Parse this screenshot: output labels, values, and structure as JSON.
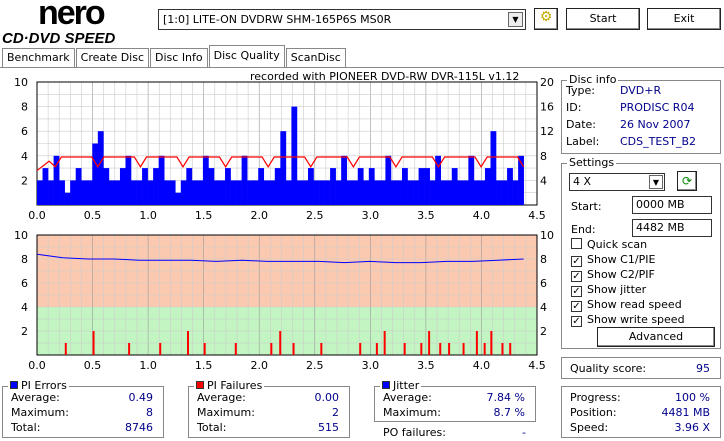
{
  "app": {
    "logo_top": "nero",
    "logo_bottom": "CD·DVD SPEED"
  },
  "toolbar": {
    "drive": "[1:0]  LITE-ON DVDRW SHM-165P6S MS0R",
    "start": "Start",
    "exit": "Exit"
  },
  "tabs": [
    "Benchmark",
    "Create Disc",
    "Disc Info",
    "Disc Quality",
    "ScanDisc"
  ],
  "active_tab": "Disc Quality",
  "recorded_with": "recorded with PIONEER DVD-RW  DVR-115L v1.12",
  "disc_info": {
    "title": "Disc info",
    "rows": [
      {
        "label": "Type:",
        "value": "DVD+R"
      },
      {
        "label": "ID:",
        "value": "PRODISC R04"
      },
      {
        "label": "Date:",
        "value": "26 Nov 2007"
      },
      {
        "label": "Label:",
        "value": "CDS_TEST_B2"
      }
    ]
  },
  "settings": {
    "title": "Settings",
    "speed": "4 X",
    "start_label": "Start:",
    "start_value": "0000 MB",
    "end_label": "End:",
    "end_value": "4482 MB",
    "checks": [
      {
        "label": "Quick scan",
        "checked": false
      },
      {
        "label": "Show C1/PIE",
        "checked": true
      },
      {
        "label": "Show C2/PIF",
        "checked": true
      },
      {
        "label": "Show jitter",
        "checked": true
      },
      {
        "label": "Show read speed",
        "checked": true
      },
      {
        "label": "Show write speed",
        "checked": true
      }
    ],
    "advanced": "Advanced"
  },
  "quality": {
    "label": "Quality score:",
    "value": "95"
  },
  "progress": {
    "rows": [
      {
        "label": "Progress:",
        "value": "100 %"
      },
      {
        "label": "Position:",
        "value": "4481 MB"
      },
      {
        "label": "Speed:",
        "value": "3.96 X"
      }
    ]
  },
  "pi_errors": {
    "title": "PI Errors",
    "color": "#0000ff",
    "rows": [
      {
        "label": "Average:",
        "value": "0.49"
      },
      {
        "label": "Maximum:",
        "value": "8"
      },
      {
        "label": "Total:",
        "value": "8746"
      }
    ]
  },
  "pi_failures": {
    "title": "PI Failures",
    "color": "#ff0000",
    "rows": [
      {
        "label": "Average:",
        "value": "0.00"
      },
      {
        "label": "Maximum:",
        "value": "2"
      },
      {
        "label": "Total:",
        "value": "515"
      }
    ]
  },
  "jitter": {
    "title": "Jitter",
    "color": "#0000ff",
    "rows": [
      {
        "label": "Average:",
        "value": "7.84 %"
      },
      {
        "label": "Maximum:",
        "value": "8.7 %"
      }
    ],
    "po_label": "PO failures:",
    "po_value": "-"
  },
  "chart_data": [
    {
      "type": "bar",
      "name": "PI errors / read speed",
      "xlim": [
        0,
        4.5
      ],
      "ylim": [
        0,
        10
      ],
      "y2lim": [
        0,
        20
      ],
      "xticks": [
        "0.0",
        "0.5",
        "1.0",
        "1.5",
        "2.0",
        "2.5",
        "3.0",
        "3.5",
        "4.0",
        "4.5"
      ],
      "yticks": [
        "10",
        "8",
        "6",
        "4",
        "2"
      ],
      "y2ticks": [
        "20",
        "16",
        "12",
        "8",
        "4"
      ],
      "pi_errors": [
        2,
        3,
        2,
        4,
        2,
        1,
        2,
        3,
        2,
        2,
        5,
        6,
        3,
        2,
        2,
        3,
        4,
        2,
        2,
        3,
        2,
        3,
        4,
        2,
        2,
        1,
        2,
        3,
        2,
        2,
        4,
        3,
        2,
        2,
        3,
        2,
        2,
        4,
        2,
        2,
        3,
        2,
        2,
        3,
        6,
        2,
        8,
        2,
        2,
        3,
        2,
        2,
        2,
        3,
        2,
        4,
        2,
        2,
        3,
        2,
        3,
        2,
        2,
        4,
        2,
        2,
        3,
        2,
        2,
        3,
        3,
        2,
        4,
        2,
        2,
        3,
        2,
        2,
        4,
        2,
        2,
        3,
        6,
        2,
        2,
        3,
        2,
        4
      ],
      "read_speed": 7.8
    },
    {
      "type": "bar",
      "name": "PI failures / jitter",
      "xlim": [
        0,
        4.5
      ],
      "ylim": [
        0,
        10
      ],
      "y2lim": [
        0,
        10
      ],
      "xticks": [
        "0.0",
        "0.5",
        "1.0",
        "1.5",
        "2.0",
        "2.5",
        "3.0",
        "3.5",
        "4.0",
        "4.5"
      ],
      "yticks": [
        "10",
        "8",
        "6",
        "4",
        "2"
      ],
      "y2ticks": [
        "10",
        "8",
        "6",
        "4",
        "2"
      ],
      "pi_failures": [
        [
          0.25,
          1
        ],
        [
          0.5,
          2
        ],
        [
          0.82,
          1
        ],
        [
          1.1,
          1
        ],
        [
          1.35,
          2
        ],
        [
          1.5,
          1
        ],
        [
          1.78,
          1
        ],
        [
          2.1,
          1
        ],
        [
          2.18,
          2
        ],
        [
          2.3,
          1
        ],
        [
          2.55,
          1
        ],
        [
          2.9,
          1
        ],
        [
          3.05,
          1
        ],
        [
          3.12,
          2
        ],
        [
          3.3,
          1
        ],
        [
          3.45,
          1
        ],
        [
          3.52,
          2
        ],
        [
          3.62,
          1
        ],
        [
          3.7,
          1
        ],
        [
          3.83,
          1
        ],
        [
          3.95,
          2
        ],
        [
          4.02,
          1
        ],
        [
          4.08,
          2
        ],
        [
          4.18,
          1
        ],
        [
          4.25,
          1
        ]
      ],
      "jitter": [
        8.4,
        8.1,
        8.0,
        8.0,
        7.9,
        7.9,
        7.9,
        7.8,
        7.9,
        7.8,
        7.8,
        7.8,
        7.7,
        7.8,
        7.7,
        7.7,
        7.8,
        7.8,
        7.9,
        8.0
      ]
    }
  ]
}
